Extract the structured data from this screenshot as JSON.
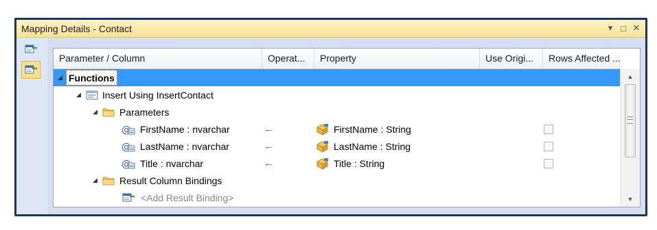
{
  "panel": {
    "title": "Mapping Details - Contact",
    "buttons": {
      "dropdown": "▾",
      "restore": "□",
      "close": "✕"
    }
  },
  "toolstrip": {
    "tools": [
      {
        "name": "map-to-entity-icon",
        "selected": false
      },
      {
        "name": "map-to-functions-icon",
        "selected": true
      }
    ]
  },
  "columns": [
    "Parameter / Column",
    "Operat...",
    "Property",
    "Use Origi...",
    "Rows Affected ..."
  ],
  "rows": [
    {
      "kind": "group",
      "label": "Functions",
      "selected": true
    },
    {
      "kind": "function",
      "label": "Insert Using InsertContact"
    },
    {
      "kind": "folder",
      "label": "Parameters"
    },
    {
      "kind": "param",
      "param": "FirstName : nvarchar",
      "op": "←",
      "property": "FirstName : String",
      "use_original": false
    },
    {
      "kind": "param",
      "param": "LastName : nvarchar",
      "op": "←",
      "property": "LastName : String",
      "use_original": false
    },
    {
      "kind": "param",
      "param": "Title : nvarchar",
      "op": "←",
      "property": "Title : String",
      "use_original": false
    },
    {
      "kind": "folder",
      "label": "Result Column Bindings"
    },
    {
      "kind": "add",
      "label": "<Add Result Binding>"
    }
  ],
  "colors": {
    "selection": "#3399ff",
    "title_bar": "#f9e7a5",
    "frame_border": "#1d3554",
    "arrow": "#3c9a2a"
  }
}
